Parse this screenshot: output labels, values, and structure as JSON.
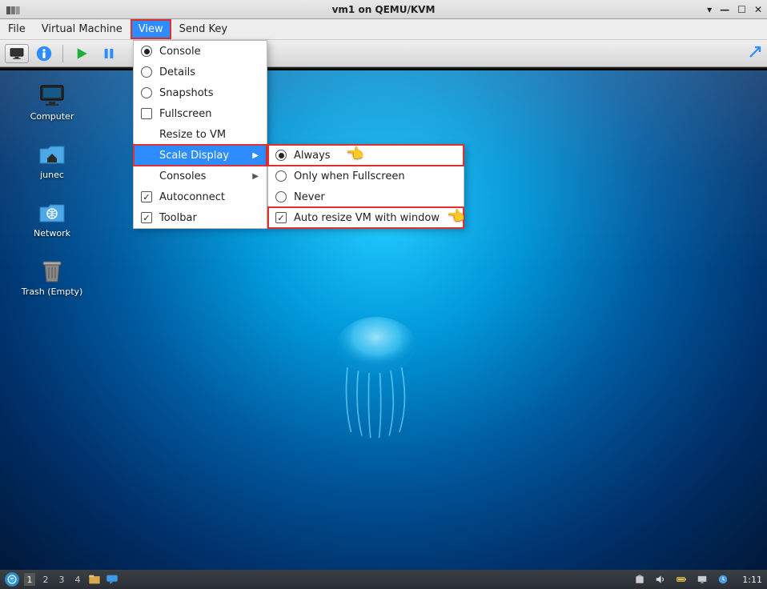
{
  "titlebar": {
    "text": "vm1 on QEMU/KVM"
  },
  "menubar": {
    "file": "File",
    "virtual_machine": "Virtual Machine",
    "view": "View",
    "send_key": "Send Key"
  },
  "view_menu": {
    "console": "Console",
    "details": "Details",
    "snapshots": "Snapshots",
    "fullscreen": "Fullscreen",
    "resize_to_vm": "Resize to VM",
    "scale_display": "Scale Display",
    "consoles": "Consoles",
    "autoconnect": "Autoconnect",
    "toolbar": "Toolbar"
  },
  "scale_menu": {
    "always": "Always",
    "only_fullscreen": "Only when Fullscreen",
    "never": "Never",
    "auto_resize": "Auto resize VM with window"
  },
  "desktop_icons": {
    "computer": "Computer",
    "junec": "junec",
    "network": "Network",
    "trash": "Trash (Empty)"
  },
  "taskbar": {
    "workspaces": [
      "1",
      "2",
      "3",
      "4"
    ],
    "clock": "1:11"
  }
}
